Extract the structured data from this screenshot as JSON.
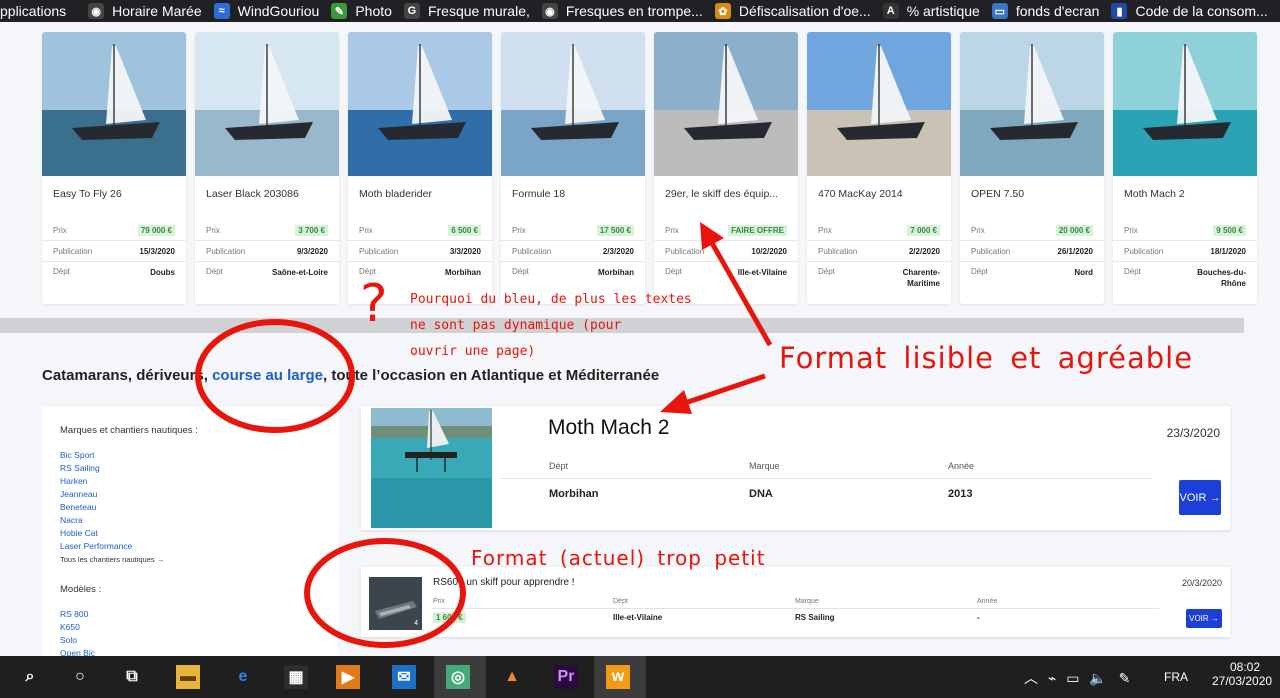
{
  "bookmarks": [
    {
      "label": "pplications",
      "icon": "apps-icon",
      "color": "#202124"
    },
    {
      "label": "Horaire Marée",
      "icon": "globe-icon",
      "color": "#444"
    },
    {
      "label": "WindGouriou",
      "icon": "wind-icon",
      "color": "#2b6fd6"
    },
    {
      "label": "Photo",
      "icon": "pen-icon",
      "color": "#3a9a3a"
    },
    {
      "label": "Fresque murale,",
      "icon": "g-icon",
      "color": "#444"
    },
    {
      "label": "Fresques en trompe...",
      "icon": "globe-icon",
      "color": "#444"
    },
    {
      "label": "Défiscalisation d'oe...",
      "icon": "art-icon",
      "color": "#d98b10"
    },
    {
      "label": "% artistique",
      "icon": "aa-icon",
      "color": "#333"
    },
    {
      "label": "fonds d'ecran",
      "icon": "screen-icon",
      "color": "#3b74c5"
    },
    {
      "label": "Code de la consom...",
      "icon": "flag-icon",
      "color": "#2448a8"
    }
  ],
  "cards": [
    {
      "title": "Easy To Fly 26",
      "prix": "79 000 €",
      "publication": "15/3/2020",
      "dept": "Doubs",
      "sky": "#9fc3dc",
      "sea": "#3b6f8e"
    },
    {
      "title": "Laser Black 203086",
      "prix": "3 700 €",
      "publication": "9/3/2020",
      "dept": "Saône-et-Loire",
      "sky": "#d7e7f2",
      "sea": "#9ab8cc"
    },
    {
      "title": "Moth bladerider",
      "prix": "6 500 €",
      "publication": "3/3/2020",
      "dept": "Morbihan",
      "sky": "#a9c9e6",
      "sea": "#2f6ea8"
    },
    {
      "title": "Formule 18",
      "prix": "17 500 €",
      "publication": "2/3/2020",
      "dept": "Morbihan",
      "sky": "#cfdff0",
      "sea": "#7aa4c8"
    },
    {
      "title": "29er, le skiff des équip...",
      "prix": "FAIRE OFFRE",
      "publication": "10/2/2020",
      "dept": "Ille-et-Vilaine",
      "sky": "#8ab0cc",
      "sea": "#bcbcbc"
    },
    {
      "title": "470 MacKay 2014",
      "prix": "7 000 €",
      "publication": "2/2/2020",
      "dept": "Charente-Maritime",
      "sky": "#6ea6dd",
      "sea": "#c8c3b4"
    },
    {
      "title": "OPEN 7.50",
      "prix": "20 000 €",
      "publication": "26/1/2020",
      "dept": "Nord",
      "sky": "#bcd6e6",
      "sea": "#7fa8bd"
    },
    {
      "title": "Moth Mach 2",
      "prix": "9 500 €",
      "publication": "18/1/2020",
      "dept": "Bouches-du-Rhône",
      "sky": "#8fd1d8",
      "sea": "#2aa3b4"
    }
  ],
  "card_labels": {
    "prix": "Prix",
    "publication": "Publication",
    "dept": "Dépt"
  },
  "section": {
    "before": "Catamarans, dériveurs, ",
    "link": "course au large",
    "after": ", toute l’occasion en Atlantique et Méditerranée"
  },
  "filters": {
    "marques_label": "Marques et chantiers nautiques :",
    "marques": [
      "Bic Sport",
      "RS Sailing",
      "Harken",
      "Jeanneau",
      "Beneteau",
      "Nacra",
      "Hobie Cat",
      "Laser Performance"
    ],
    "marques_more": "Tous les chantiers nautiques →",
    "modeles_label": "Modèles :",
    "modeles": [
      "RS 800",
      "K650",
      "Solo",
      "Open Bic"
    ]
  },
  "big_listing": {
    "name": "Moth Mach 2",
    "date": "23/3/2020",
    "dept_label": "Dépt",
    "marque_label": "Marque",
    "annee_label": "Année",
    "dept": "Morbihan",
    "marque": "DNA",
    "annee": "2013",
    "voir": "VOIR →"
  },
  "small_listing": {
    "name": "RS600 un skiff pour apprendre !",
    "date": "20/3/2020",
    "prix_label": "Prix",
    "dept_label": "Dépt",
    "marque_label": "Marque",
    "annee_label": "Année",
    "prix": "1 600 €",
    "dept": "Ille-et-Vilaine",
    "marque": "RS Sailing",
    "annee": "-",
    "photo_count": "4",
    "voir": "VOIR →"
  },
  "annotations": {
    "question": "?",
    "bleu_1": "Pourquoi du bleu, de plus les textes",
    "bleu_2": "ne sont pas dynamique (pour",
    "bleu_3": "ouvrir une page)",
    "lisible": "Format lisible et agréable",
    "petit": "Format (actuel) trop petit",
    "color": "#e8150c"
  },
  "taskbar": {
    "lang": "FRA",
    "time": "08:02",
    "date": "27/03/2020",
    "apps": [
      "search-icon",
      "cortana-icon",
      "task-view-icon",
      "file-explorer-icon",
      "edge-icon",
      "store-icon",
      "media-icon",
      "mail-icon",
      "chrome-icon",
      "vlc-icon",
      "premiere-icon",
      "w-app-icon"
    ]
  }
}
